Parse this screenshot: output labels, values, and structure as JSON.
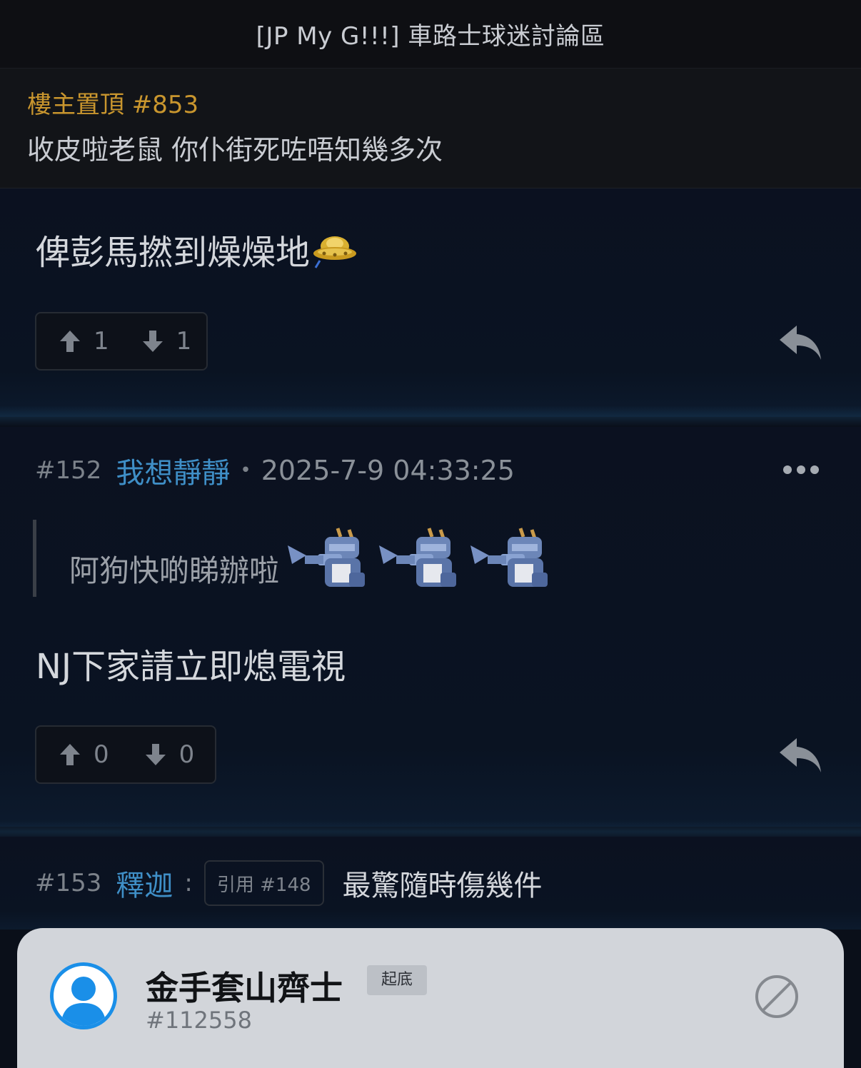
{
  "header": {
    "title": "[JP My G!!!] 車路士球迷討論區"
  },
  "pinned": {
    "label": "樓主置頂 #853",
    "text": "收皮啦老鼠 你仆街死咗唔知幾多次"
  },
  "post1": {
    "text": "俾彭馬撚到燥燥地",
    "emoji_icon": "ufo-emoji-icon",
    "upvotes": "1",
    "downvotes": "1"
  },
  "post2": {
    "number": "#152",
    "author": "我想靜靜",
    "separator": "•",
    "time": "2025-7-9 04:33:25",
    "quote_text": "阿狗快啲睇辦啦",
    "quote_emojis": [
      "dragon-emoji-icon",
      "dragon-emoji-icon",
      "dragon-emoji-icon"
    ],
    "text": "NJ下家請立即熄電視",
    "upvotes": "0",
    "downvotes": "0"
  },
  "post3": {
    "number": "#153",
    "author": "釋迦",
    "colon": ":",
    "quote_ref": "引用 #148",
    "snippet": "最驚隨時傷幾件"
  },
  "profile_sheet": {
    "name": "金手套山齊士",
    "badge": "起底",
    "id": "#112558"
  },
  "colors": {
    "author": "#3f8fc7",
    "pinned_label": "#c9962e",
    "avatar_ring": "#1a8fe8"
  }
}
